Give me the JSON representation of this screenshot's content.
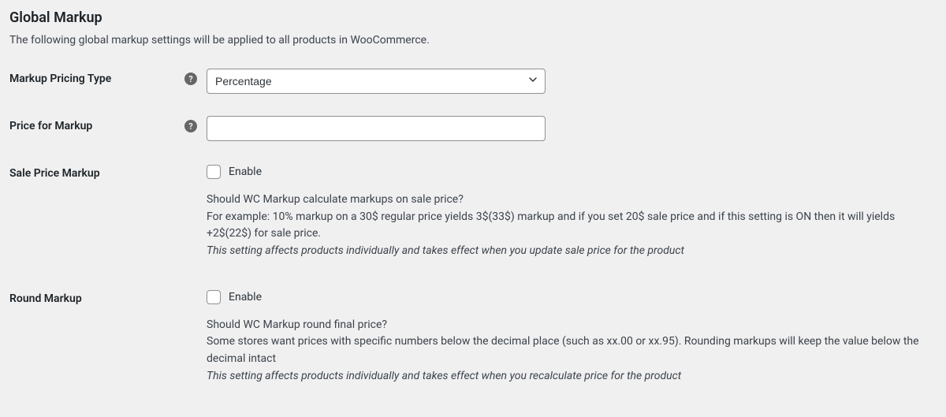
{
  "section": {
    "heading": "Global Markup",
    "intro": "The following global markup settings will be applied to all products in WooCommerce."
  },
  "fields": {
    "pricing_type": {
      "label": "Markup Pricing Type",
      "value": "Percentage"
    },
    "price_for_markup": {
      "label": "Price for Markup",
      "value": ""
    },
    "sale_price_markup": {
      "label": "Sale Price Markup",
      "checkbox_label": "Enable",
      "desc1": "Should WC Markup calculate markups on sale price?",
      "desc2": "For example: 10% markup on a 30$ regular price yields 3$(33$) markup and if you set 20$ sale price and if this setting is ON then it will yields +2$(22$) for sale price.",
      "desc3": "This setting affects products individually and takes effect when you update sale price for the product"
    },
    "round_markup": {
      "label": "Round Markup",
      "checkbox_label": "Enable",
      "desc1": "Should WC Markup round final price?",
      "desc2": "Some stores want prices with specific numbers below the decimal place (such as xx.00 or xx.95). Rounding markups will keep the value below the decimal intact",
      "desc3": "This setting affects products individually and takes effect when you recalculate price for the product"
    }
  }
}
